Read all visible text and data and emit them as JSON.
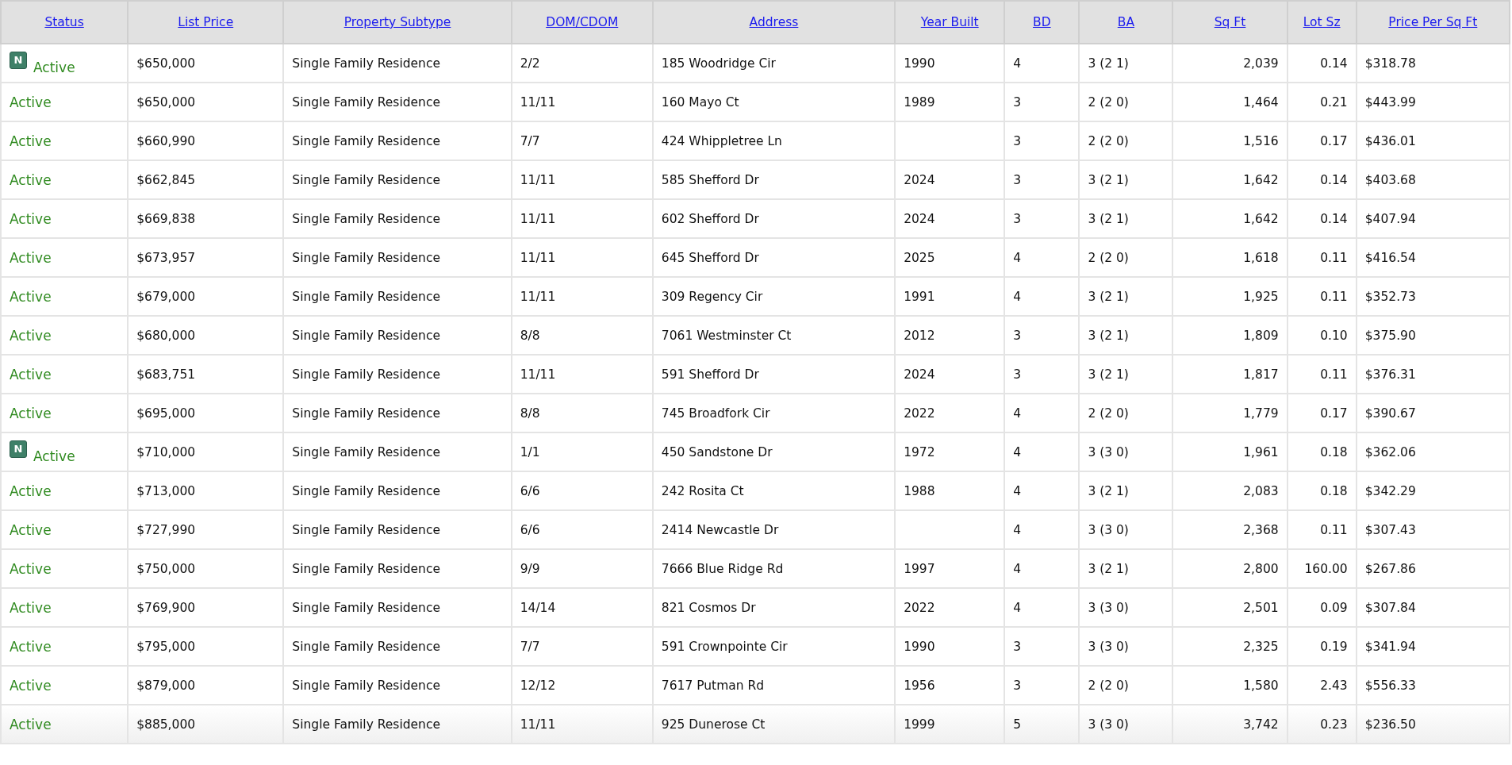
{
  "table": {
    "columns": [
      "Status",
      "List Price",
      "Property Subtype",
      "DOM/CDOM",
      "Address",
      "Year Built",
      "BD",
      "BA",
      "Sq Ft",
      "Lot Sz",
      "Price Per Sq Ft"
    ],
    "rows": [
      {
        "badge": "N",
        "cells": [
          "Active",
          "$650,000",
          "Single Family Residence",
          "2/2",
          "185 Woodridge Cir",
          "1990",
          "4",
          "3 (2 1)",
          "2,039",
          "0.14",
          "$318.78"
        ]
      },
      {
        "cells": [
          "Active",
          "$650,000",
          "Single Family Residence",
          "11/11",
          "160 Mayo Ct",
          "1989",
          "3",
          "2 (2 0)",
          "1,464",
          "0.21",
          "$443.99"
        ]
      },
      {
        "cells": [
          "Active",
          "$660,990",
          "Single Family Residence",
          "7/7",
          "424 Whippletree Ln",
          "",
          "3",
          "2 (2 0)",
          "1,516",
          "0.17",
          "$436.01"
        ]
      },
      {
        "cells": [
          "Active",
          "$662,845",
          "Single Family Residence",
          "11/11",
          "585 Shefford Dr",
          "2024",
          "3",
          "3 (2 1)",
          "1,642",
          "0.14",
          "$403.68"
        ]
      },
      {
        "cells": [
          "Active",
          "$669,838",
          "Single Family Residence",
          "11/11",
          "602 Shefford Dr",
          "2024",
          "3",
          "3 (2 1)",
          "1,642",
          "0.14",
          "$407.94"
        ]
      },
      {
        "cells": [
          "Active",
          "$673,957",
          "Single Family Residence",
          "11/11",
          "645 Shefford Dr",
          "2025",
          "4",
          "2 (2 0)",
          "1,618",
          "0.11",
          "$416.54"
        ]
      },
      {
        "cells": [
          "Active",
          "$679,000",
          "Single Family Residence",
          "11/11",
          "309 Regency Cir",
          "1991",
          "4",
          "3 (2 1)",
          "1,925",
          "0.11",
          "$352.73"
        ]
      },
      {
        "cells": [
          "Active",
          "$680,000",
          "Single Family Residence",
          "8/8",
          "7061 Westminster Ct",
          "2012",
          "3",
          "3 (2 1)",
          "1,809",
          "0.10",
          "$375.90"
        ]
      },
      {
        "cells": [
          "Active",
          "$683,751",
          "Single Family Residence",
          "11/11",
          "591 Shefford Dr",
          "2024",
          "3",
          "3 (2 1)",
          "1,817",
          "0.11",
          "$376.31"
        ]
      },
      {
        "cells": [
          "Active",
          "$695,000",
          "Single Family Residence",
          "8/8",
          "745 Broadfork Cir",
          "2022",
          "4",
          "2 (2 0)",
          "1,779",
          "0.17",
          "$390.67"
        ]
      },
      {
        "badge": "N",
        "cells": [
          "Active",
          "$710,000",
          "Single Family Residence",
          "1/1",
          "450 Sandstone Dr",
          "1972",
          "4",
          "3 (3 0)",
          "1,961",
          "0.18",
          "$362.06"
        ]
      },
      {
        "cells": [
          "Active",
          "$713,000",
          "Single Family Residence",
          "6/6",
          "242 Rosita Ct",
          "1988",
          "4",
          "3 (2 1)",
          "2,083",
          "0.18",
          "$342.29"
        ]
      },
      {
        "cells": [
          "Active",
          "$727,990",
          "Single Family Residence",
          "6/6",
          "2414 Newcastle Dr",
          "",
          "4",
          "3 (3 0)",
          "2,368",
          "0.11",
          "$307.43"
        ]
      },
      {
        "cells": [
          "Active",
          "$750,000",
          "Single Family Residence",
          "9/9",
          "7666 Blue Ridge Rd",
          "1997",
          "4",
          "3 (2 1)",
          "2,800",
          "160.00",
          "$267.86"
        ]
      },
      {
        "cells": [
          "Active",
          "$769,900",
          "Single Family Residence",
          "14/14",
          "821 Cosmos Dr",
          "2022",
          "4",
          "3 (3 0)",
          "2,501",
          "0.09",
          "$307.84"
        ]
      },
      {
        "cells": [
          "Active",
          "$795,000",
          "Single Family Residence",
          "7/7",
          "591 Crownpointe Cir",
          "1990",
          "3",
          "3 (3 0)",
          "2,325",
          "0.19",
          "$341.94"
        ]
      },
      {
        "cells": [
          "Active",
          "$879,000",
          "Single Family Residence",
          "12/12",
          "7617 Putman Rd",
          "1956",
          "3",
          "2 (2 0)",
          "1,580",
          "2.43",
          "$556.33"
        ]
      },
      {
        "cells": [
          "Active",
          "$885,000",
          "Single Family Residence",
          "11/11",
          "925 Dunerose Ct",
          "1999",
          "5",
          "3 (3 0)",
          "3,742",
          "0.23",
          "$236.50"
        ]
      }
    ]
  }
}
